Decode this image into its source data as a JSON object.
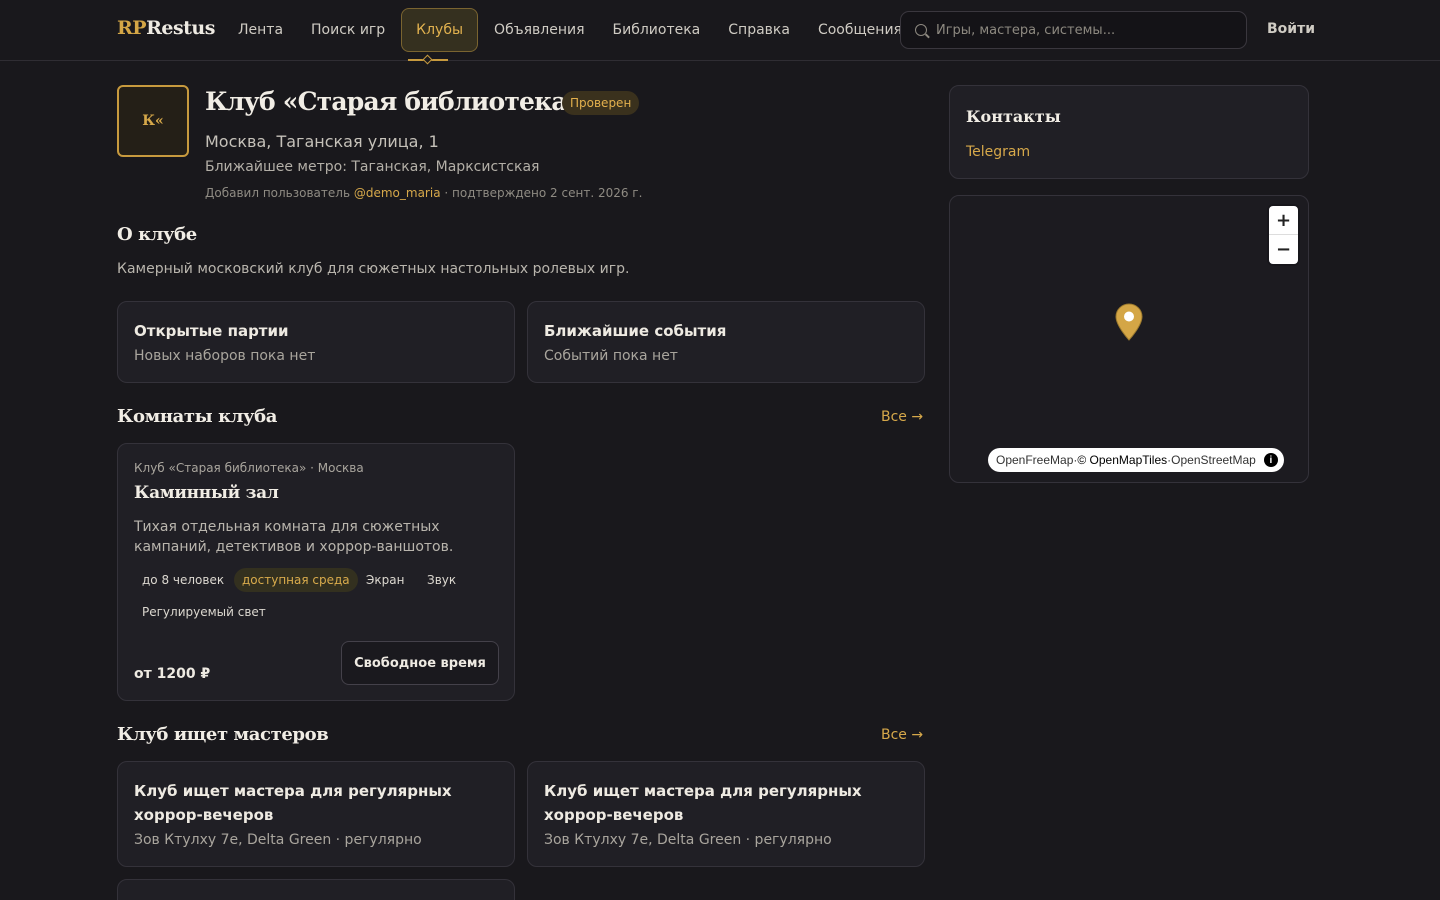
{
  "header": {
    "logo_rp": "RP",
    "logo_rest": "Restus",
    "nav": [
      {
        "label": "Лента"
      },
      {
        "label": "Поиск игр"
      },
      {
        "label": "Клубы"
      },
      {
        "label": "Объявления"
      },
      {
        "label": "Библиотека"
      },
      {
        "label": "Справка"
      },
      {
        "label": "Сообщения"
      }
    ],
    "active_nav": "Клубы",
    "search_placeholder": "Игры, мастера, системы...",
    "login_label": "Войти"
  },
  "club": {
    "avatar_text": "К«",
    "title": "Клуб «Старая библиотека»",
    "verified_badge": "Проверен",
    "address": "Москва, Таганская улица, 1",
    "metro": "Ближайшее метро: Таганская, Марксистская",
    "added_prefix": "Добавил пользователь",
    "added_user": "@demo_maria",
    "added_suffix": "· подтверждено 2 сент. 2026 г."
  },
  "about": {
    "title": "О клубе",
    "text": "Камерный московский клуб для сюжетных настольных ролевых игр."
  },
  "open_games": {
    "title": "Открытые партии",
    "empty": "Новых наборов пока нет"
  },
  "events": {
    "title": "Ближайшие события",
    "empty": "Событий пока нет"
  },
  "rooms": {
    "title": "Комнаты клуба",
    "see_all": "Все →",
    "items": [
      {
        "meta": "Клуб «Старая библиотека» · Москва",
        "name": "Каминный зал",
        "description": "Тихая отдельная комната для сюжетных кампаний, детективов и хоррор-ваншотов.",
        "tags": [
          "до 8 человек",
          "доступная среда",
          "Экран",
          "Звук",
          "Регулируемый свет"
        ],
        "price": "от 1200 ₽",
        "button": "Свободное время"
      }
    ]
  },
  "gm_search": {
    "title": "Клуб ищет мастеров",
    "see_all": "Все →",
    "items": [
      {
        "title": "Клуб ищет мастера для регулярных хоррор-вечеров",
        "subtitle": "Зов Ктулху 7е, Delta Green · регулярно"
      },
      {
        "title": "Клуб ищет мастера для регулярных хоррор-вечеров",
        "subtitle": "Зов Ктулху 7е, Delta Green · регулярно"
      }
    ]
  },
  "contacts": {
    "title": "Контакты",
    "telegram": "Telegram"
  },
  "map": {
    "zoom_in": "+",
    "zoom_out": "−",
    "attribution_1": "OpenFreeMap",
    "attribution_sep": " · ",
    "attribution_2": "© OpenMapTiles",
    "attribution_3": "OpenStreetMap",
    "info_icon": "i",
    "pin_color": "#d4a646"
  },
  "colors": {
    "accent": "#d4a646",
    "background": "#19181c",
    "card": "#201f25"
  }
}
